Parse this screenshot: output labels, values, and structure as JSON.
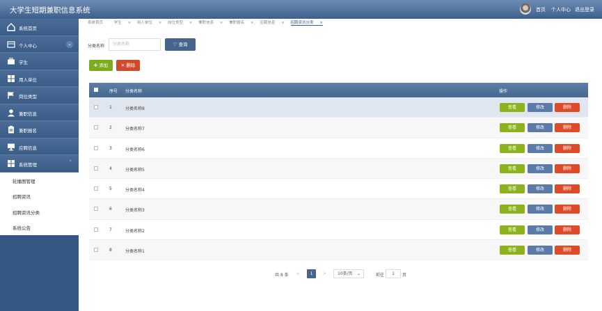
{
  "app_title": "大学生短期兼职信息系统",
  "header_nav": [
    "首页",
    "个人中心",
    "退出登录"
  ],
  "sidebar": {
    "items": [
      {
        "label": "系统首页",
        "icon": "home-icon"
      },
      {
        "label": "个人中心",
        "icon": "card-icon",
        "expandable": true
      },
      {
        "label": "学生",
        "icon": "briefcase-icon"
      },
      {
        "label": "用人单位",
        "icon": "grid-icon"
      },
      {
        "label": "岗位类型",
        "icon": "flag-icon"
      },
      {
        "label": "兼职信息",
        "icon": "user-icon"
      },
      {
        "label": "兼职报名",
        "icon": "clipboard-icon"
      },
      {
        "label": "应聘信息",
        "icon": "monitor-icon"
      },
      {
        "label": "系统管理",
        "icon": "grid-icon",
        "expanded": true
      }
    ],
    "sub_items": [
      "轮播图管理",
      "招聘资讯",
      "招聘资讯分类",
      "系统公告"
    ]
  },
  "tabs": [
    "系统首页",
    "学生",
    "用人单位",
    "岗位类型",
    "兼职信息",
    "兼职报名",
    "应聘信息",
    "招聘资讯分类"
  ],
  "search": {
    "label": "分类名称",
    "placeholder": "分类名称",
    "button": "查询"
  },
  "toolbar": {
    "add": "添加",
    "delete": "删除"
  },
  "table": {
    "headers": {
      "index": "序号",
      "name": "分类名称",
      "ops": "操作"
    },
    "rows": [
      {
        "index": "1",
        "name": "分类名称8"
      },
      {
        "index": "2",
        "name": "分类名称7"
      },
      {
        "index": "3",
        "name": "分类名称6"
      },
      {
        "index": "4",
        "name": "分类名称5"
      },
      {
        "index": "5",
        "name": "分类名称4"
      },
      {
        "index": "6",
        "name": "分类名称3"
      },
      {
        "index": "7",
        "name": "分类名称2"
      },
      {
        "index": "8",
        "name": "分类名称1"
      }
    ],
    "actions": {
      "view": "查看",
      "edit": "修改",
      "delete": "删除"
    }
  },
  "pager": {
    "total": "共 8 条",
    "prev": "<",
    "current": "1",
    "next": ">",
    "page_size": "10条/页",
    "goto": "前往",
    "goto_value": "1",
    "page_unit": "页"
  },
  "colors": {
    "header": "#4a6c96",
    "sidebar": "#355882",
    "view": "#8db31c",
    "edit": "#5a7aa8",
    "delete": "#df4b29"
  }
}
